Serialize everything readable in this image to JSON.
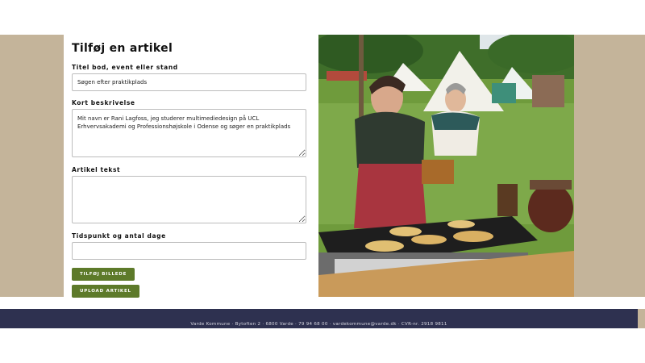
{
  "form": {
    "title": "Tilføj en artikel",
    "fields": {
      "title_label": "Titel bod, event eller stand",
      "title_value": "Søgen efter praktikplads",
      "description_label": "Kort beskrivelse",
      "description_value": "Mit navn er Rani Lagfoss, jeg studerer multimediedesign på UCL Erhvervsakademi og Professionshøjskole i Odense og søger en praktikplads",
      "article_label": "Artikel tekst",
      "article_value": "",
      "period_label": "Tidspunkt og antal dage",
      "period_value": ""
    },
    "buttons": {
      "add_image": "TILFØJ BILLEDE",
      "upload": "UPLOAD ARTIKEL"
    }
  },
  "photo": {
    "icon": "medieval-market-cooking-photo"
  },
  "footer": {
    "text": "Varde Kommune · Bytoften 2 · 6800 Varde · 79 94 68 00 · vardekommune@varde.dk · CVR-nr. 2918 9811"
  },
  "colors": {
    "band": "#c4b49a",
    "button": "#5d7a2a",
    "footer": "#2e3150"
  }
}
